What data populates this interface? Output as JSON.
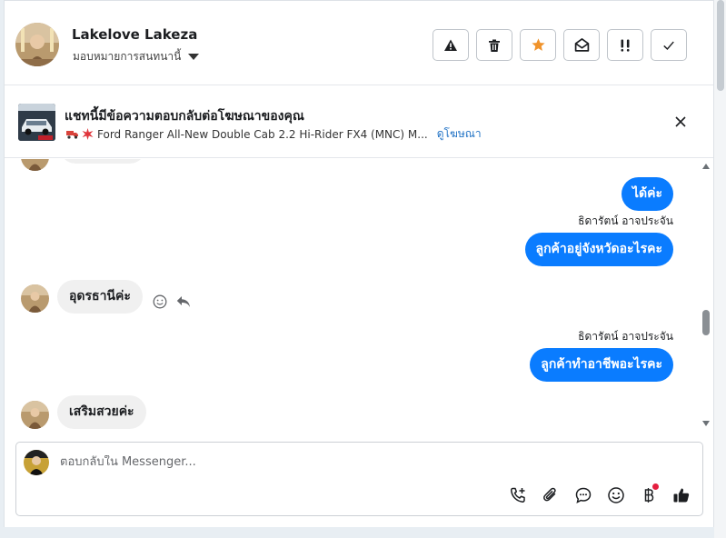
{
  "header": {
    "user_name": "Lakelove Lakeza",
    "assign_label": "มอบหมายการสนทนานี้",
    "actions": [
      {
        "name": "spam-report",
        "icon": "warning-icon"
      },
      {
        "name": "delete",
        "icon": "trash-icon"
      },
      {
        "name": "star",
        "icon": "star-icon",
        "color": "#f0932b"
      },
      {
        "name": "mark-unread",
        "icon": "envelope-open-icon"
      },
      {
        "name": "follow-up",
        "icon": "double-exclamation-icon"
      },
      {
        "name": "mark-done",
        "icon": "check-icon"
      }
    ]
  },
  "ad": {
    "title": "แชทนี้มีข้อความตอบกลับต่อโฆษณาของคุณ",
    "description": "Ford Ranger All-New Double Cab 2.2 Hi-Rider FX4 (MNC) M...",
    "link_label": "ดูโฆษณา"
  },
  "messages": [
    {
      "direction": "out",
      "text": "ได้ค่ะ"
    },
    {
      "direction": "out",
      "sender": "ธิดารัตน์ อาจประจัน",
      "text": "ลูกค้าอยู่จังหวัดอะไรคะ"
    },
    {
      "direction": "in",
      "text": "อุดรธานีค่ะ"
    },
    {
      "direction": "out",
      "sender": "ธิดารัตน์ อาจประจัน",
      "text": "ลูกค้าทำอาชีพอะไรคะ"
    },
    {
      "direction": "in",
      "text": "เสริมสวยค่ะ"
    }
  ],
  "composer": {
    "placeholder": "ตอบกลับใน Messenger...",
    "value": "",
    "tools": [
      "call-add-icon",
      "paperclip-icon",
      "chat-bubble-icon",
      "emoji-icon",
      "baht-icon",
      "thumbs-up-icon"
    ]
  },
  "colors": {
    "accent": "#0a7cff",
    "star": "#f0932b",
    "notification_dot": "#e41e3f",
    "link": "#2374c6"
  }
}
